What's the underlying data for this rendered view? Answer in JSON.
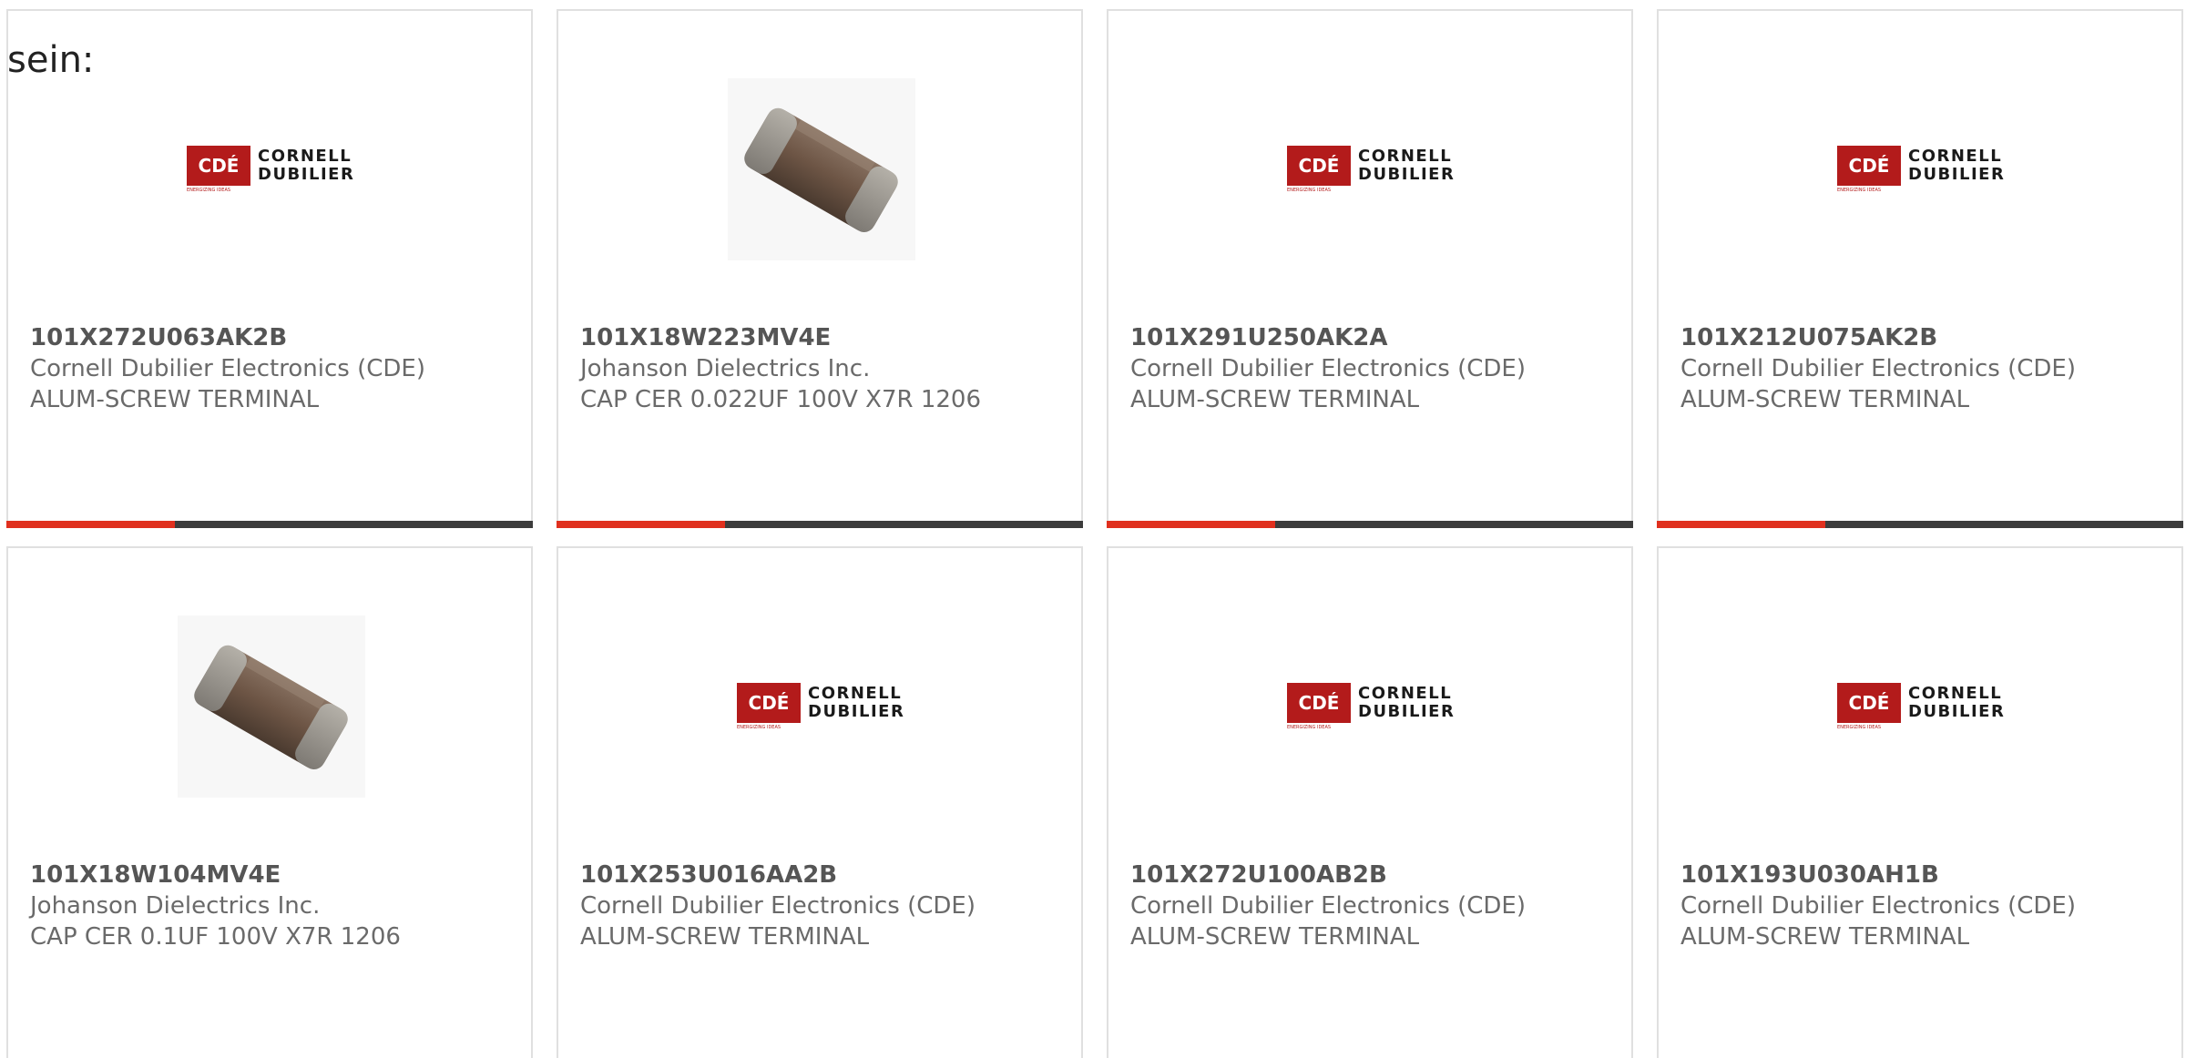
{
  "lead_text": "sein:",
  "brand_colors": {
    "accent": "#e0301e",
    "bar_track": "#3c3c3c",
    "logo_red": "#b31b1b"
  },
  "logo": {
    "box_text": "CDÉ",
    "line1": "CORNELL",
    "line2": "DUBILIER",
    "tagline": "ENERGIZING IDEAS"
  },
  "cards": [
    {
      "part_number": "101X272U063AK2B",
      "manufacturer": "Cornell Dubilier Electronics (CDE)",
      "description": "ALUM-SCREW TERMINAL",
      "image": "cde-logo",
      "progress": 0.32
    },
    {
      "part_number": "101X18W223MV4E",
      "manufacturer": "Johanson Dielectrics Inc.",
      "description": "CAP CER 0.022UF 100V X7R 1206",
      "image": "ceramic-chip-capacitor",
      "progress": 0.32
    },
    {
      "part_number": "101X291U250AK2A",
      "manufacturer": "Cornell Dubilier Electronics (CDE)",
      "description": "ALUM-SCREW TERMINAL",
      "image": "cde-logo",
      "progress": 0.32
    },
    {
      "part_number": "101X212U075AK2B",
      "manufacturer": "Cornell Dubilier Electronics (CDE)",
      "description": "ALUM-SCREW TERMINAL",
      "image": "cde-logo",
      "progress": 0.32
    },
    {
      "part_number": "101X18W104MV4E",
      "manufacturer": "Johanson Dielectrics Inc.",
      "description": "CAP CER 0.1UF 100V X7R 1206",
      "image": "ceramic-chip-capacitor"
    },
    {
      "part_number": "101X253U016AA2B",
      "manufacturer": "Cornell Dubilier Electronics (CDE)",
      "description": "ALUM-SCREW TERMINAL",
      "image": "cde-logo"
    },
    {
      "part_number": "101X272U100AB2B",
      "manufacturer": "Cornell Dubilier Electronics (CDE)",
      "description": "ALUM-SCREW TERMINAL",
      "image": "cde-logo"
    },
    {
      "part_number": "101X193U030AH1B",
      "manufacturer": "Cornell Dubilier Electronics (CDE)",
      "description": "ALUM-SCREW TERMINAL",
      "image": "cde-logo"
    }
  ]
}
